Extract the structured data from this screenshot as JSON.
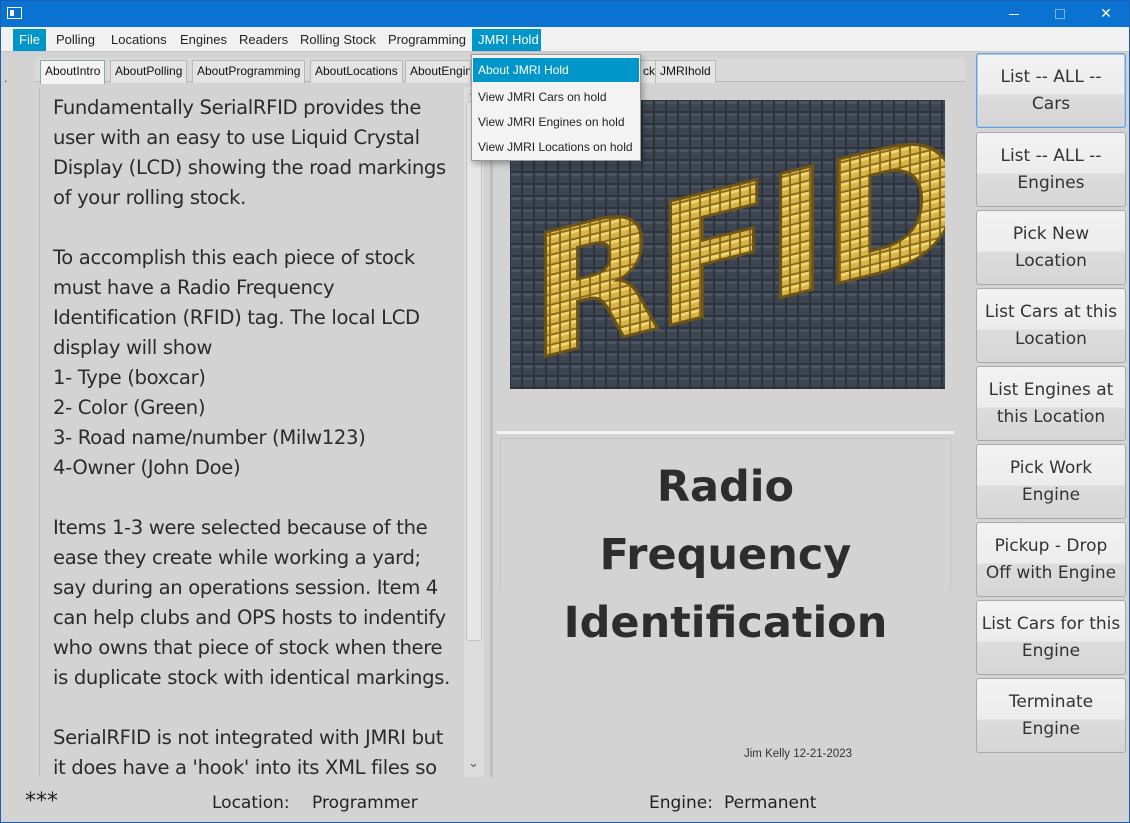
{
  "window": {
    "icon": "window-icon",
    "controls": {
      "minimize": "minimize-icon",
      "maximize": "maximize-icon",
      "close": "✕"
    }
  },
  "menubar": {
    "items": [
      "File",
      "Polling",
      "Locations",
      "Engines",
      "Readers",
      "Rolling Stock",
      "Programming",
      "JMRI Hold"
    ],
    "active": [
      "File",
      "JMRI Hold"
    ]
  },
  "jmri_menu": {
    "items": [
      "About JMRI Hold",
      "View JMRI Cars on hold",
      "View JMRI Engines on hold",
      "View JMRI Locations on hold"
    ],
    "selected": "About JMRI Hold"
  },
  "tabs": {
    "items": [
      "AboutIntro",
      "AboutPolling",
      "AboutProgramming",
      "AboutLocations",
      "AboutEngines",
      "ck",
      "JMRIhold"
    ],
    "visible_labels": [
      "AboutIntro",
      "AboutPolling",
      "AboutProgramming",
      "AboutLocations",
      "AboutEngin",
      "ck",
      "JMRIhold"
    ],
    "selected": "AboutIntro"
  },
  "intro_text": "Fundamentally SerialRFID provides the user with an easy to use Liquid Crystal Display (LCD) showing the road markings of your rolling stock.\n\nTo accomplish this each piece of stock must have a Radio Frequency Identification (RFID) tag. The local LCD display will show\n1- Type (boxcar)\n2- Color (Green)\n3- Road name/number (Milw123)\n4-Owner (John Doe)\n\nItems 1-3 were selected because of the ease they create while working a yard; say during an operations session. Item 4 can help clubs and OPS hosts to indentify who owns that piece of stock when there is duplicate stock with identical markings.\n\nSerialRFID is not integrated with JMRI but it does have a 'hook' into its XML files so that if you have entered your engines, cars and",
  "image": {
    "text": "RFID",
    "colors": {
      "background": "#2f3640",
      "letters": "#d9b84a"
    }
  },
  "title": {
    "lines": [
      "Radio",
      "Frequency",
      "Identification"
    ]
  },
  "author": "Jim Kelly 12-21-2023",
  "buttons": [
    {
      "label": "List -- ALL -- Cars",
      "line1": "List -- ALL --",
      "line2": "Cars",
      "focused": true
    },
    {
      "label": "List -- ALL -- Engines",
      "line1": "List -- ALL --",
      "line2": "Engines"
    },
    {
      "label": "Pick New Location",
      "line1": "Pick New",
      "line2": "Location"
    },
    {
      "label": "List Cars at this Location",
      "line1": "List Cars at this",
      "line2": "Location"
    },
    {
      "label": "List Engines at this Location",
      "line1": "List Engines at",
      "line2": "this Location"
    },
    {
      "label": "Pick Work Engine",
      "line1": "Pick Work",
      "line2": "Engine"
    },
    {
      "label": "Pickup - Drop Off with Engine",
      "line1": "Pickup - Drop",
      "line2": "Off with Engine"
    },
    {
      "label": "List Cars for this Engine",
      "line1": "List Cars for this",
      "line2": "Engine"
    },
    {
      "label": "Terminate Engine",
      "line1": "Terminate",
      "line2": "Engine"
    }
  ],
  "status": {
    "stars": "***",
    "location_label": "Location:",
    "location_value": "Programmer",
    "engine_label": "Engine:",
    "engine_value": "Permanent"
  },
  "colors": {
    "titlebar": "#0a73d1",
    "menu_highlight": "#0096c9",
    "panel": "#d3d3d3"
  }
}
